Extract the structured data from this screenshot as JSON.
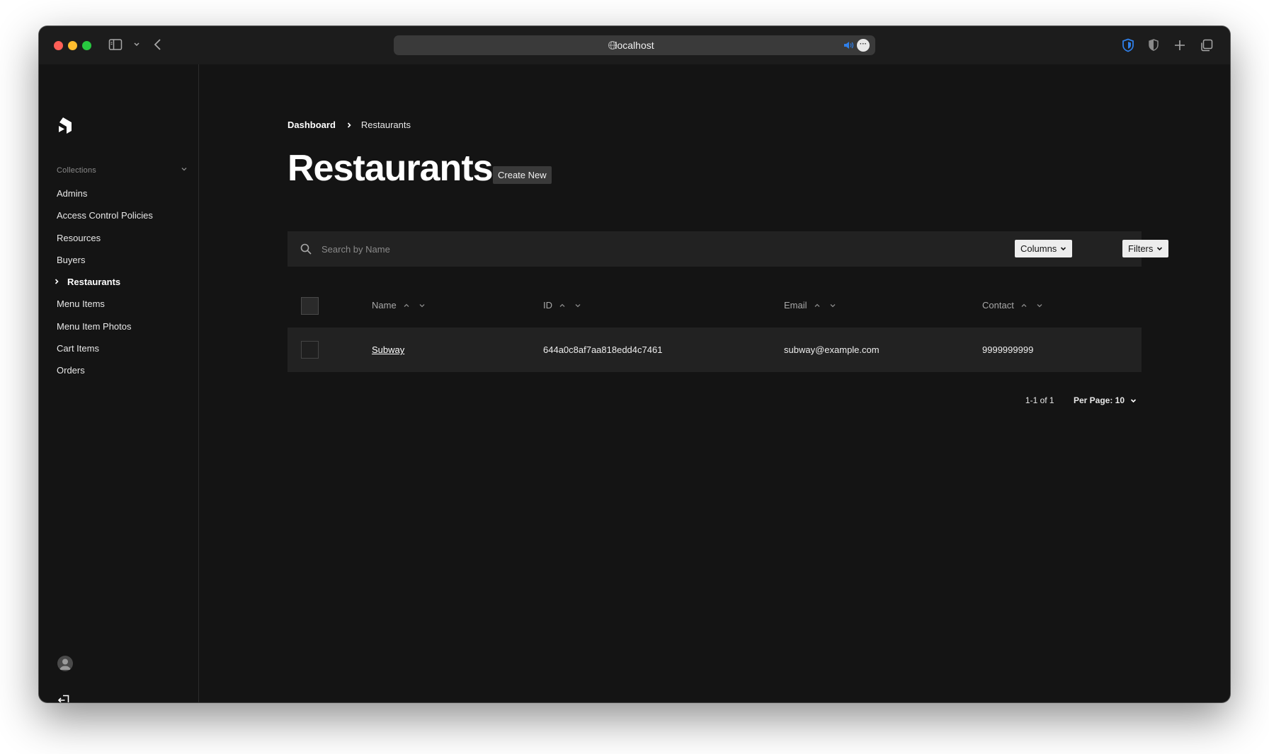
{
  "browser": {
    "url": "localhost"
  },
  "sidebar": {
    "section_label": "Collections",
    "items": [
      {
        "label": "Admins"
      },
      {
        "label": "Access Control Policies"
      },
      {
        "label": "Resources"
      },
      {
        "label": "Buyers"
      },
      {
        "label": "Restaurants",
        "active": true
      },
      {
        "label": "Menu Items"
      },
      {
        "label": "Menu Item Photos"
      },
      {
        "label": "Cart Items"
      },
      {
        "label": "Orders"
      }
    ]
  },
  "breadcrumb": {
    "root": "Dashboard",
    "current": "Restaurants"
  },
  "page": {
    "title": "Restaurants",
    "create_label": "Create New"
  },
  "search": {
    "placeholder": "Search by Name",
    "value": ""
  },
  "toolbar": {
    "columns_label": "Columns",
    "filters_label": "Filters"
  },
  "table": {
    "columns": [
      "Name",
      "ID",
      "Email",
      "Contact"
    ],
    "rows": [
      {
        "name": "Subway",
        "id": "644a0c8af7aa818edd4c7461",
        "email": "subway@example.com",
        "contact": "9999999999"
      }
    ]
  },
  "pagination": {
    "range": "1-1 of 1",
    "per_page": "Per Page: 10"
  },
  "colors": {
    "background": "#141414",
    "panel": "#222222",
    "accent_shield": "#2f7fe8"
  }
}
